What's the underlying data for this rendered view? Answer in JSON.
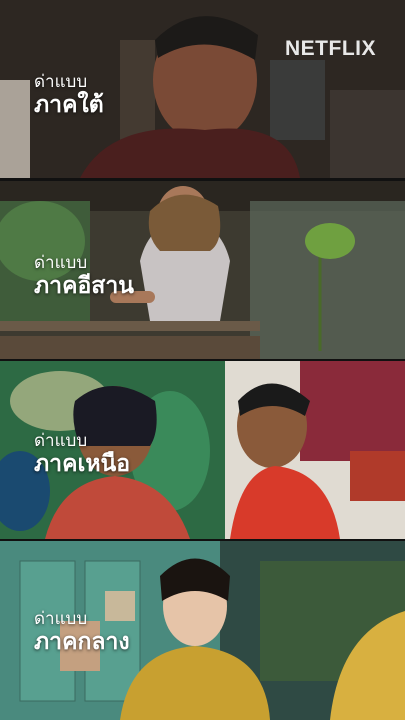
{
  "logo": "NETFLIX",
  "panels": [
    {
      "caption_small": "ด่าแบบ",
      "caption_big": "ภาคใต้"
    },
    {
      "caption_small": "ด่าแบบ",
      "caption_big": "ภาคอีสาน"
    },
    {
      "caption_small": "ด่าแบบ",
      "caption_big": "ภาคเหนือ"
    },
    {
      "caption_small": "ด่าแบบ",
      "caption_big": "ภาคกลาง"
    }
  ]
}
